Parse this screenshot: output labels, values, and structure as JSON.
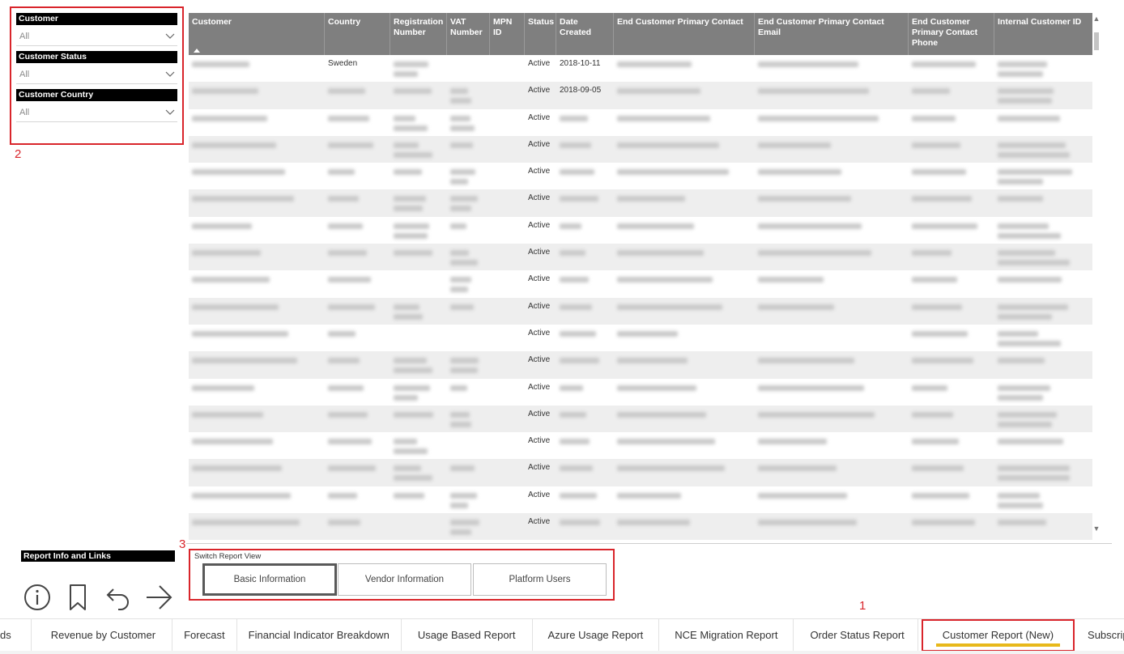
{
  "filters": [
    {
      "title": "Customer",
      "value": "All"
    },
    {
      "title": "Customer Status",
      "value": "All"
    },
    {
      "title": "Customer Country",
      "value": "All"
    }
  ],
  "callouts": {
    "tabs": "1",
    "filters": "2",
    "switch": "3"
  },
  "table": {
    "columns": [
      "Customer",
      "Country",
      "Registration Number",
      "VAT Number",
      "MPN ID",
      "Status",
      "Date Created",
      "End Customer Primary Contact",
      "End Customer Primary Contact Email",
      "End Customer Primary Contact Phone",
      "Internal Customer ID"
    ],
    "rows": [
      {
        "country": "Sweden",
        "status": "Active",
        "date": "2018-10-11"
      },
      {
        "country": "",
        "status": "Active",
        "date": "2018-09-05"
      },
      {
        "country": "",
        "status": "Active",
        "date": ""
      },
      {
        "country": "",
        "status": "Active",
        "date": ""
      },
      {
        "country": "",
        "status": "Active",
        "date": ""
      },
      {
        "country": "",
        "status": "Active",
        "date": ""
      },
      {
        "country": "",
        "status": "Active",
        "date": ""
      },
      {
        "country": "",
        "status": "Active",
        "date": ""
      },
      {
        "country": "",
        "status": "Active",
        "date": ""
      },
      {
        "country": "",
        "status": "Active",
        "date": ""
      },
      {
        "country": "",
        "status": "Active",
        "date": ""
      },
      {
        "country": "",
        "status": "Active",
        "date": ""
      },
      {
        "country": "",
        "status": "Active",
        "date": ""
      },
      {
        "country": "",
        "status": "Active",
        "date": ""
      },
      {
        "country": "",
        "status": "Active",
        "date": ""
      },
      {
        "country": "",
        "status": "Active",
        "date": ""
      },
      {
        "country": "",
        "status": "Active",
        "date": ""
      },
      {
        "country": "",
        "status": "Active",
        "date": ""
      }
    ]
  },
  "report_info": {
    "title": "Report Info and Links",
    "icons": [
      "info-icon",
      "bookmark-icon",
      "back-arrow-icon",
      "forward-arrow-icon"
    ]
  },
  "switch_view": {
    "label": "Switch Report View",
    "buttons": [
      "Basic Information",
      "Vendor Information",
      "Platform Users"
    ],
    "active": "Basic Information"
  },
  "tabs": [
    "ds",
    "Revenue by Customer",
    "Forecast",
    "Financial Indicator Breakdown",
    "Usage Based Report",
    "Azure Usage Report",
    "NCE Migration Report",
    "Order Status Report",
    "Customer Report (New)",
    "Subscription Report"
  ],
  "active_tab": "Customer Report (New)",
  "colors": {
    "callout": "#d9252b",
    "header_bg": "#7f7f7f",
    "tab_underline": "#e8b81a"
  }
}
